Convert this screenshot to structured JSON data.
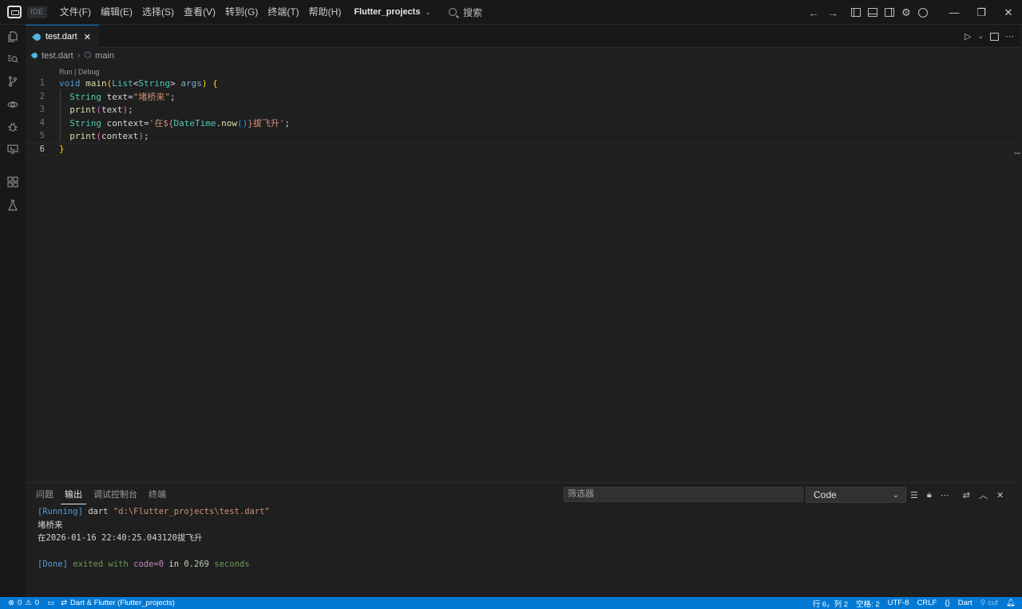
{
  "title_bar": {
    "badge": "IDE",
    "menu": [
      "文件(F)",
      "编辑(E)",
      "选择(S)",
      "查看(V)",
      "转到(G)",
      "终端(T)",
      "帮助(H)"
    ],
    "project": "Flutter_projects",
    "search_label": "搜索"
  },
  "editor": {
    "tab_name": "test.dart",
    "breadcrumb": {
      "file": "test.dart",
      "symbol": "main"
    },
    "code_lens": "Run | Debug",
    "line_numbers": [
      "1",
      "2",
      "3",
      "4",
      "5",
      "6"
    ],
    "code": {
      "l1": {
        "kw": "void",
        "fn": "main",
        "ty1": "List",
        "ty2": "String",
        "param": "args"
      },
      "l2": {
        "ty": "String",
        "var": "text",
        "str": "\"堵桥来\""
      },
      "l3": {
        "fn": "print",
        "arg": "text"
      },
      "l4": {
        "ty": "String",
        "var": "context",
        "str1": "'在${",
        "cls": "DateTime",
        "method": "now",
        "str2": "}拔飞升'"
      },
      "l5": {
        "fn": "print",
        "arg": "context"
      },
      "l6": "}"
    }
  },
  "panel": {
    "tabs": [
      "问题",
      "输出",
      "调试控制台",
      "终端"
    ],
    "active_tab": "输出",
    "filter_placeholder": "筛选器",
    "channel": "Code",
    "output": {
      "running_tag": "[Running]",
      "running_cmd": " dart ",
      "running_path": "\"d:\\Flutter_projects\\test.dart\"",
      "line2": "堵桥来",
      "line3": "在2026-01-16 22:40:25.043120拔飞升",
      "done_tag": "[Done]",
      "done_a": " exited with ",
      "done_code": "code=0",
      "done_b": " in ",
      "done_time": "0.269",
      "done_c": " seconds"
    }
  },
  "status_bar": {
    "errors": "0",
    "warnings": "0",
    "target": "Dart & Flutter (Flutter_projects)",
    "position": "行 6，列 2",
    "spaces": "空格: 2",
    "encoding": "UTF-8",
    "eol": "CRLF",
    "braces": "{}",
    "language": "Dart",
    "extra": "⚲ cuf"
  },
  "colors": {
    "accent": "#0078d4",
    "background": "#1f1f1f",
    "chrome": "#181818"
  }
}
